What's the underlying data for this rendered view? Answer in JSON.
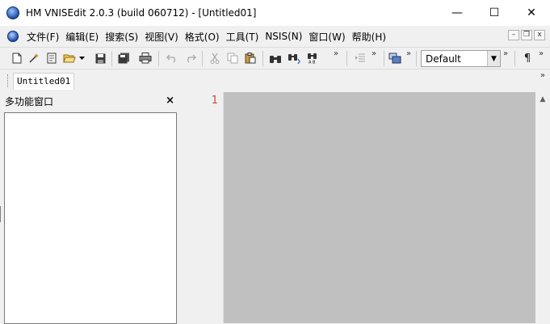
{
  "window": {
    "title": "HM VNISEdit 2.0.3 (build 060712) - [Untitled01]",
    "minimize": "—",
    "maximize": "☐",
    "close": "✕"
  },
  "menu": {
    "items": [
      {
        "label": "文件(F)"
      },
      {
        "label": "编辑(E)"
      },
      {
        "label": "搜索(S)"
      },
      {
        "label": "视图(V)"
      },
      {
        "label": "格式(O)"
      },
      {
        "label": "工具(T)"
      },
      {
        "label": "NSIS(N)"
      },
      {
        "label": "窗口(W)"
      },
      {
        "label": "帮助(H)"
      }
    ],
    "mdi_minimize": "–",
    "mdi_restore": "❐",
    "mdi_close": "x"
  },
  "toolbar": {
    "style_select": {
      "value": "Default"
    },
    "chevron": "»",
    "pilcrow": "¶"
  },
  "tabs": [
    {
      "label": "Untitled01"
    }
  ],
  "tab_chevron": "»",
  "panel": {
    "title": "多功能窗口",
    "close": "×"
  },
  "editor": {
    "line_numbers": [
      "1"
    ]
  },
  "icons": {
    "new": "new-file-icon",
    "wizard": "wizard-icon",
    "template": "template-icon",
    "open": "open-folder-icon",
    "save": "save-icon",
    "save_all": "save-all-icon",
    "print": "print-icon",
    "undo": "undo-icon",
    "redo": "redo-icon",
    "cut": "cut-icon",
    "copy": "copy-icon",
    "paste": "paste-icon",
    "find": "find-icon",
    "find_next": "find-next-icon",
    "replace": "replace-icon",
    "indent": "indent-icon",
    "compile": "compile-icon"
  },
  "colors": {
    "editor_background": "#c0c0c0",
    "line_number": "#d24040"
  }
}
